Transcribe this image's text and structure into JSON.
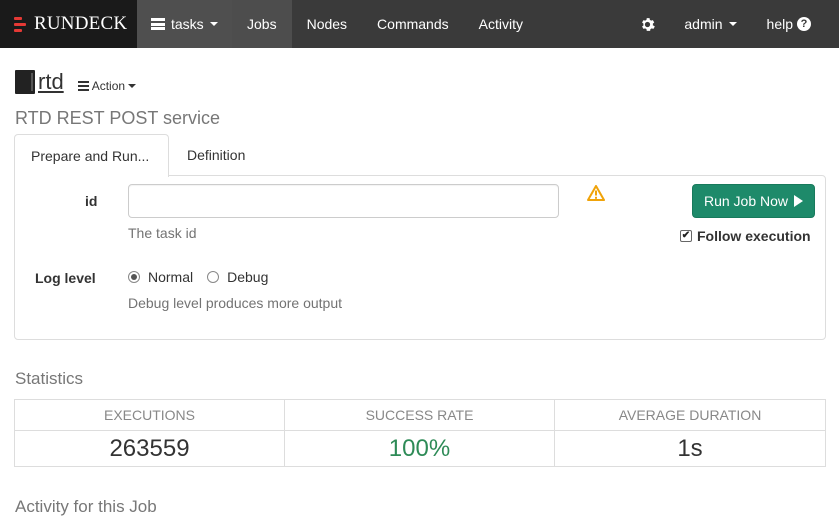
{
  "navbar": {
    "brand": "RUNDECK",
    "tasks_label": "tasks",
    "items": [
      "Jobs",
      "Nodes",
      "Commands",
      "Activity"
    ],
    "user_label": "admin",
    "help_label": "help",
    "colors": {
      "background": "#3a3a3a",
      "brand_bg": "#1a1a1a",
      "brand_accent": "#e53935"
    }
  },
  "job": {
    "name": "rtd",
    "action_label": "Action",
    "description": "RTD REST POST service"
  },
  "tabs": [
    "Prepare and Run...",
    "Definition"
  ],
  "form": {
    "id_label": "id",
    "id_value": "",
    "id_help": "The task id",
    "run_button": "Run Job Now",
    "follow_label": "Follow execution",
    "follow_checked": true,
    "loglevel_label": "Log level",
    "loglevel_options": [
      "Normal",
      "Debug"
    ],
    "loglevel_selected": "Normal",
    "loglevel_help": "Debug level produces more output",
    "colors": {
      "run_button": "#1e8a6a",
      "warning": "#f0a30a"
    }
  },
  "statistics": {
    "title": "Statistics",
    "headers": [
      "EXECUTIONS",
      "SUCCESS RATE",
      "AVERAGE DURATION"
    ],
    "values": [
      "263559",
      "100%",
      "1s"
    ],
    "colors": {
      "success_rate": "#2e8b57"
    }
  },
  "activity": {
    "title": "Activity for this Job"
  }
}
